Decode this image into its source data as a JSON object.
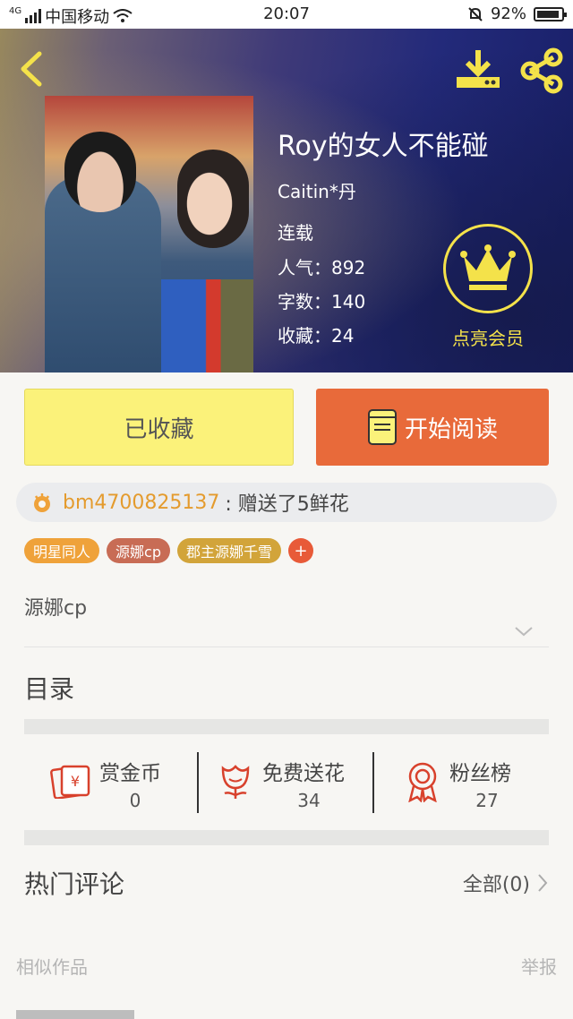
{
  "status_bar": {
    "network": "4G",
    "carrier": "中国移动",
    "time": "20:07",
    "battery": "92%"
  },
  "book": {
    "title": "Roy的女人不能碰",
    "author": "Caitin*丹",
    "status": "连载",
    "popularity_label": "人气：892",
    "wordcount_label": "字数：140",
    "favorites_label": "收藏：24"
  },
  "vip": {
    "label": "点亮会员"
  },
  "actions": {
    "collected_label": "已收藏",
    "read_label": "开始阅读"
  },
  "gift": {
    "user": "bm4700825137",
    "text": ": 赠送了5鲜花"
  },
  "tags": [
    {
      "label": "明星同人",
      "color": "#efa23a"
    },
    {
      "label": "源娜cp",
      "color": "#c86c55"
    },
    {
      "label": "郡主源娜千雪",
      "color": "#d2a43a"
    }
  ],
  "tag_add_label": "+",
  "description": "源娜cp",
  "catalog_title": "目录",
  "stats": [
    {
      "label": "赏金币",
      "value": "0"
    },
    {
      "label": "免费送花",
      "value": "34"
    },
    {
      "label": "粉丝榜",
      "value": "27"
    }
  ],
  "comments": {
    "title": "热门评论",
    "all_label": "全部(0)"
  },
  "similar": {
    "title": "相似作品",
    "report_label": "举报"
  },
  "colors": {
    "accent_yellow": "#fbf27a",
    "accent_orange": "#e86a3a",
    "icon_red": "#d8412c",
    "vip_gold": "#f4e24a"
  }
}
